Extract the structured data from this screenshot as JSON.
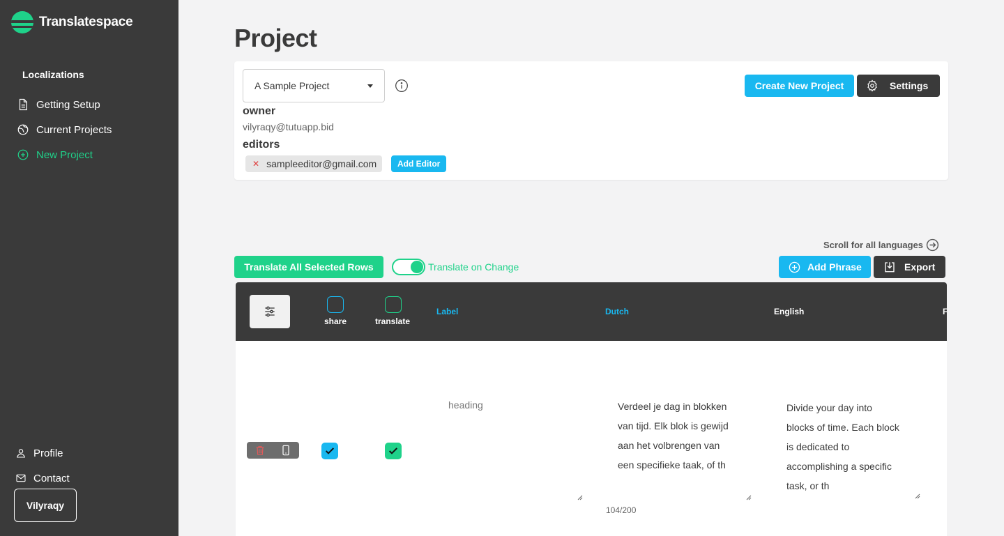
{
  "brand": {
    "name": "Translatespace"
  },
  "sidebar": {
    "heading": "Localizations",
    "items": [
      {
        "label": "Getting Setup",
        "icon": "document-icon"
      },
      {
        "label": "Current Projects",
        "icon": "globe-icon"
      },
      {
        "label": "New Project",
        "icon": "plus-circle-icon"
      }
    ],
    "bottom": [
      {
        "label": "Profile",
        "icon": "user-icon"
      },
      {
        "label": "Contact",
        "icon": "mail-icon"
      }
    ],
    "user": "Vilyraqy"
  },
  "page": {
    "title": "Project"
  },
  "project": {
    "selected": "A Sample Project",
    "owner_label": "owner",
    "owner_email": "vilyraqy@tutuapp.bid",
    "editors_label": "editors",
    "editors": [
      "sampleeditor@gmail.com"
    ],
    "add_editor": "Add Editor",
    "create_new": "Create New Project",
    "settings": "Settings"
  },
  "toolbar": {
    "scroll_hint": "Scroll for all languages",
    "translate_all": "Translate All Selected Rows",
    "translate_on_change": "Translate on Change",
    "translate_on_change_enabled": true,
    "add_phrase": "Add Phrase",
    "export": "Export"
  },
  "table": {
    "head": {
      "share": "share",
      "translate": "translate",
      "columns": [
        "Label",
        "Dutch",
        "English",
        "F"
      ]
    },
    "rows": [
      {
        "share": true,
        "translate": true,
        "label": "heading",
        "dutch": "Verdeel je dag in blokken\nvan tijd. Elk blok is gewijd\naan het volbrengen van\neen specifieke taak, of th",
        "english": "Divide your day into\nblocks of time. Each block\nis dedicated to\naccomplishing a specific\ntask, or th",
        "counter": "104/200"
      }
    ]
  },
  "colors": {
    "sidebar": "#3a3a3a",
    "accent_green": "#1fd28a",
    "accent_blue": "#19b8f0",
    "background": "#f3f3f4"
  }
}
